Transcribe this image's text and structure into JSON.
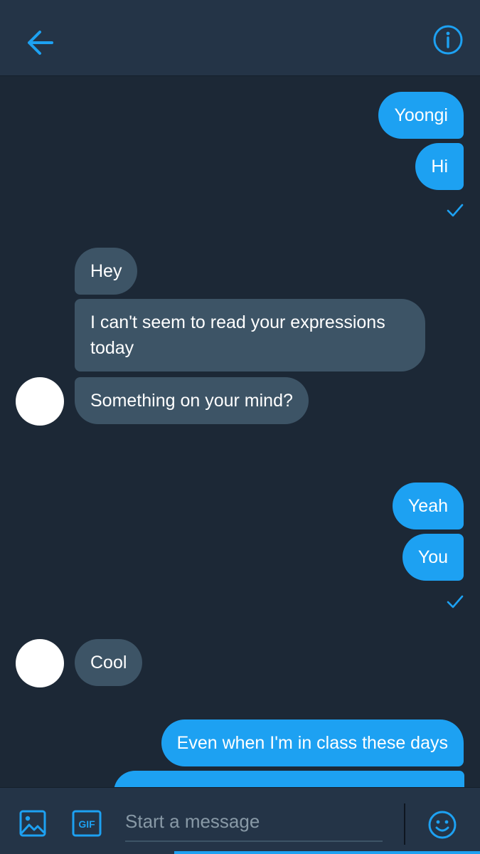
{
  "header": {
    "back_icon": "arrow-left-icon",
    "info_icon": "info-circle-icon",
    "accent": "#1da1f2"
  },
  "messages": [
    {
      "side": "sent",
      "text": "Yoongi"
    },
    {
      "side": "sent",
      "text": "Hi"
    },
    {
      "side": "received",
      "text": "Hey"
    },
    {
      "side": "received",
      "text": "I can't seem to read your expressions today"
    },
    {
      "side": "received",
      "text": "Something on your mind?"
    },
    {
      "side": "sent",
      "text": "Yeah"
    },
    {
      "side": "sent",
      "text": "You"
    },
    {
      "side": "received",
      "text": "Cool"
    },
    {
      "side": "sent",
      "text": "Even when I'm in class these days"
    }
  ],
  "composer": {
    "placeholder": "Start a message",
    "gif_label": "GIF",
    "photo_icon": "image-icon",
    "emoji_icon": "smiley-icon"
  },
  "colors": {
    "background": "#1c2836",
    "header": "#243447",
    "sent_bubble": "#1da1f2",
    "received_bubble": "#3d5466"
  }
}
